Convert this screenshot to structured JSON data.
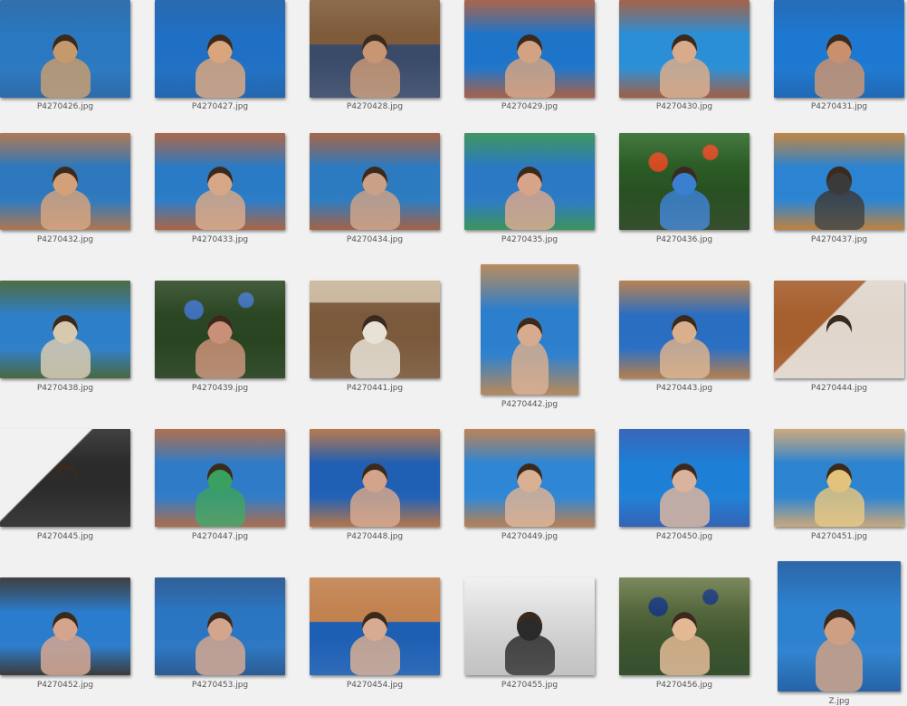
{
  "gallery": {
    "items": [
      {
        "label": "P4270426.jpg",
        "palette": [
          "#2a78c0",
          "#1b5fa3",
          "#c49a6c"
        ],
        "tone": "pool"
      },
      {
        "label": "P4270427.jpg",
        "palette": [
          "#1f6fc4",
          "#135aa8",
          "#d9a57c"
        ],
        "tone": "pool"
      },
      {
        "label": "P4270428.jpg",
        "palette": [
          "#7f5b3a",
          "#3a4b6a",
          "#c89673"
        ],
        "tone": "deck"
      },
      {
        "label": "P4270429.jpg",
        "palette": [
          "#1e74c9",
          "#a0543a",
          "#d2a283"
        ],
        "tone": "pool"
      },
      {
        "label": "P4270430.jpg",
        "palette": [
          "#2a8fd6",
          "#9a5135",
          "#d9ab8a"
        ],
        "tone": "pool"
      },
      {
        "label": "P4270431.jpg",
        "palette": [
          "#1c78d0",
          "#0f5cb0",
          "#c9906d"
        ],
        "tone": "pool"
      },
      {
        "label": "P4270432.jpg",
        "palette": [
          "#2d78bd",
          "#a66b41",
          "#d4a07a"
        ],
        "tone": "pool"
      },
      {
        "label": "P4270433.jpg",
        "palette": [
          "#2a7bc6",
          "#a35736",
          "#d6a786"
        ],
        "tone": "pool"
      },
      {
        "label": "P4270434.jpg",
        "palette": [
          "#2c7ac0",
          "#9b5536",
          "#caa086"
        ],
        "tone": "pool"
      },
      {
        "label": "P4270435.jpg",
        "palette": [
          "#2b79c4",
          "#2b8a50",
          "#d7a48a"
        ],
        "tone": "pool"
      },
      {
        "label": "P4270436.jpg",
        "palette": [
          "#2f6a2a",
          "#d24a22",
          "#3a7fd0"
        ],
        "tone": "garden"
      },
      {
        "label": "P4270437.jpg",
        "palette": [
          "#2b83d1",
          "#b9782f",
          "#3a3a3a"
        ],
        "tone": "pool"
      },
      {
        "label": "P4270438.jpg",
        "palette": [
          "#2e7fc9",
          "#3b5c2f",
          "#d7c9b0"
        ],
        "tone": "pool"
      },
      {
        "label": "P4270439.jpg",
        "palette": [
          "#2f4a26",
          "#3f6fb8",
          "#c98f77"
        ],
        "tone": "garden"
      },
      {
        "label": "P4270441.jpg",
        "palette": [
          "#c8b59a",
          "#7b5a3c",
          "#e8e2d6"
        ],
        "tone": "hut"
      },
      {
        "label": "P4270442.jpg",
        "palette": [
          "#2c7fcd",
          "#b17f4c",
          "#d7ab8d"
        ],
        "tone": "pool"
      },
      {
        "label": "P4270443.jpg",
        "palette": [
          "#2a6ec2",
          "#b0743f",
          "#d9b08b"
        ],
        "tone": "pool"
      },
      {
        "label": "P4270444.jpg",
        "palette": [
          "#a65f2e",
          "#2c2c2c",
          "#e0d6cc"
        ],
        "tone": "balcony"
      },
      {
        "label": "P4270445.jpg",
        "palette": [
          "#f0f0f0",
          "#5a3b22",
          "#2b2b2b"
        ],
        "tone": "balcony"
      },
      {
        "label": "P4270447.jpg",
        "palette": [
          "#2f7bc7",
          "#a8603c",
          "#39a060"
        ],
        "tone": "pool"
      },
      {
        "label": "P4270448.jpg",
        "palette": [
          "#1f5fb4",
          "#b06a3a",
          "#d3a48a"
        ],
        "tone": "pool"
      },
      {
        "label": "P4270449.jpg",
        "palette": [
          "#2e86d4",
          "#b47543",
          "#d9b094"
        ],
        "tone": "pool"
      },
      {
        "label": "P4270450.jpg",
        "palette": [
          "#1d7fd6",
          "#2356b0",
          "#d9b39c"
        ],
        "tone": "pool"
      },
      {
        "label": "P4270451.jpg",
        "palette": [
          "#2c84d0",
          "#c7a06f",
          "#e3c37c"
        ],
        "tone": "pool"
      },
      {
        "label": "P4270452.jpg",
        "palette": [
          "#2a7ccc",
          "#2b2b2b",
          "#d5a48d"
        ],
        "tone": "pool"
      },
      {
        "label": "P4270453.jpg",
        "palette": [
          "#2b76c2",
          "#1b4f8c",
          "#d3a58c"
        ],
        "tone": "pool"
      },
      {
        "label": "P4270454.jpg",
        "palette": [
          "#c2824f",
          "#1d5fb3",
          "#d7ab8f"
        ],
        "tone": "deck"
      },
      {
        "label": "P4270455.jpg",
        "palette": [
          "#efefef",
          "#bdbdbd",
          "#2a2a2a"
        ],
        "tone": "room"
      },
      {
        "label": "P4270456.jpg",
        "palette": [
          "#6d7b4c",
          "#1e3c78",
          "#e2b993"
        ],
        "tone": "garden"
      },
      {
        "label": "Z.jpg",
        "palette": [
          "#2d82cf",
          "#14569f",
          "#cf9f82"
        ],
        "tone": "pool"
      }
    ]
  }
}
